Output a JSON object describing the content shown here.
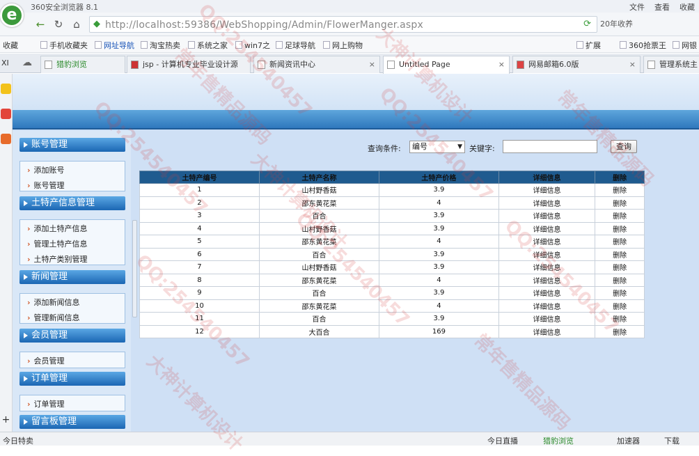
{
  "titlebar": {
    "app_title": "360安全浏览器 8.1",
    "menu": [
      "文件",
      "查看",
      "收藏"
    ]
  },
  "addressbar": {
    "url": "http://localhost:59386/WebShopping/Admin/FlowerManger.aspx",
    "extra": "20年收养"
  },
  "favbar": {
    "items": [
      "收藏",
      "手机收藏夹",
      "网址导航",
      "淘宝热卖",
      "系统之家",
      "win7之",
      "足球导航",
      "网上购物",
      "扩展",
      "360抢票王",
      "网银"
    ]
  },
  "tabs": [
    {
      "label": "XI"
    },
    {
      "label": "猎豹浏览"
    },
    {
      "label": "jsp - 计算机专业毕业设计源"
    },
    {
      "label": "新闻资讯中心"
    },
    {
      "label": "Untitled Page"
    },
    {
      "label": "网易邮箱6.0版"
    },
    {
      "label": "管理系统主"
    }
  ],
  "sidebar": {
    "sections": [
      {
        "title": "账号管理",
        "items": [
          "添加账号",
          "账号管理"
        ]
      },
      {
        "title": "土特产信息管理",
        "items": [
          "添加土特产信息",
          "管理土特产信息",
          "土特产类别管理"
        ]
      },
      {
        "title": "新闻管理",
        "items": [
          "添加新闻信息",
          "管理新闻信息"
        ]
      },
      {
        "title": "会员管理",
        "items": [
          "会员管理"
        ]
      },
      {
        "title": "订单管理",
        "items": [
          "订单管理"
        ]
      },
      {
        "title": "留言板管理",
        "items": []
      }
    ]
  },
  "query": {
    "condition_label": "查询条件:",
    "select_value": "编号",
    "keyword_label": "关键字:",
    "keyword_value": "",
    "button": "查询"
  },
  "table": {
    "headers": [
      "土特产编号",
      "土特产名称",
      "土特产价格",
      "详细信息",
      "删除"
    ],
    "rows": [
      [
        "1",
        "山村野香菇",
        "3.9",
        "详细信息",
        "删除"
      ],
      [
        "2",
        "邵东黄花菜",
        "4",
        "详细信息",
        "删除"
      ],
      [
        "3",
        "百合",
        "3.9",
        "详细信息",
        "删除"
      ],
      [
        "4",
        "山村野香菇",
        "3.9",
        "详细信息",
        "删除"
      ],
      [
        "5",
        "邵东黄花菜",
        "4",
        "详细信息",
        "删除"
      ],
      [
        "6",
        "百合",
        "3.9",
        "详细信息",
        "删除"
      ],
      [
        "7",
        "山村野香菇",
        "3.9",
        "详细信息",
        "删除"
      ],
      [
        "8",
        "邵东黄花菜",
        "4",
        "详细信息",
        "删除"
      ],
      [
        "9",
        "百合",
        "3.9",
        "详细信息",
        "删除"
      ],
      [
        "10",
        "邵东黄花菜",
        "4",
        "详细信息",
        "删除"
      ],
      [
        "11",
        "百合",
        "3.9",
        "详细信息",
        "删除"
      ],
      [
        "12",
        "大百合",
        "169",
        "详细信息",
        "删除"
      ]
    ]
  },
  "statusbar": {
    "left": "今日特卖",
    "items": [
      "今日直播",
      "猎豹浏览",
      "加速器",
      "下载"
    ]
  },
  "watermarks": [
    "QQ:254540457",
    "大神计算机设计",
    "常年售精品源码"
  ]
}
